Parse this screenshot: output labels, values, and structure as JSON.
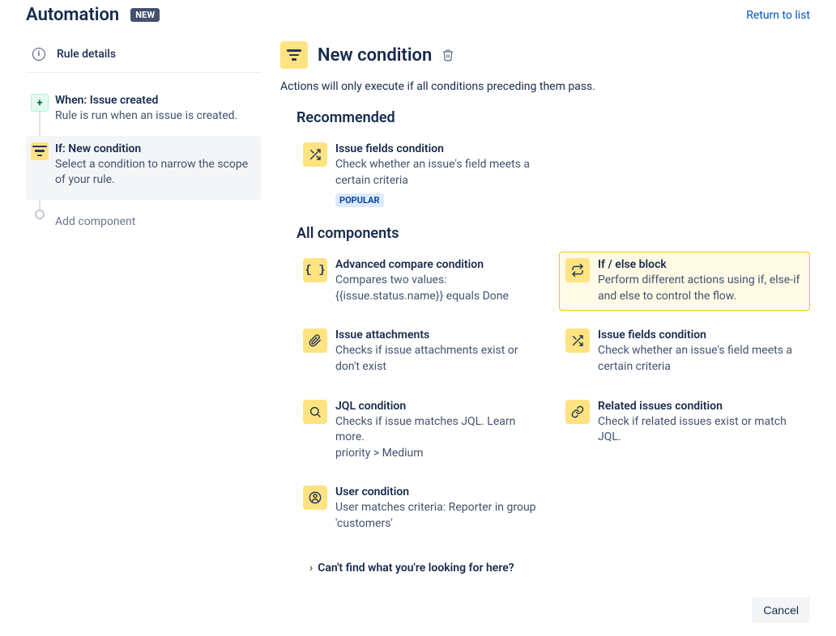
{
  "header": {
    "title": "Automation",
    "newBadge": "NEW",
    "returnLink": "Return to list"
  },
  "sidebar": {
    "ruleDetails": "Rule details",
    "steps": [
      {
        "title": "When: Issue created",
        "desc": "Rule is run when an issue is created."
      },
      {
        "title": "If: New condition",
        "desc": "Select a condition to narrow the scope of your rule."
      }
    ],
    "addComponent": "Add component"
  },
  "panel": {
    "title": "New condition",
    "subtitle": "Actions will only execute if all conditions preceding them pass.",
    "recommendedHeading": "Recommended",
    "allHeading": "All components",
    "recommended": {
      "title": "Issue fields condition",
      "desc": "Check whether an issue's field meets a certain criteria",
      "badge": "POPULAR"
    },
    "components": [
      {
        "title": "Advanced compare condition",
        "desc": "Compares two values: {{issue.status.name}} equals Done",
        "icon": "braces"
      },
      {
        "title": "If / else block",
        "desc": "Perform different actions using if, else-if and else to control the flow.",
        "icon": "branch",
        "selected": true
      },
      {
        "title": "Issue attachments",
        "desc": "Checks if issue attachments exist or don't exist",
        "icon": "clip"
      },
      {
        "title": "Issue fields condition",
        "desc": "Check whether an issue's field meets a certain criteria",
        "icon": "shuffle"
      },
      {
        "title": "JQL condition",
        "desc": "Checks if issue matches JQL. Learn more.\npriority > Medium",
        "icon": "search"
      },
      {
        "title": "Related issues condition",
        "desc": "Check if related issues exist or match JQL.",
        "icon": "link"
      },
      {
        "title": "User condition",
        "desc": "User matches criteria: Reporter in group 'customers'",
        "icon": "user"
      }
    ],
    "cantFind": "Can't find what you're looking for here?",
    "cancel": "Cancel"
  }
}
